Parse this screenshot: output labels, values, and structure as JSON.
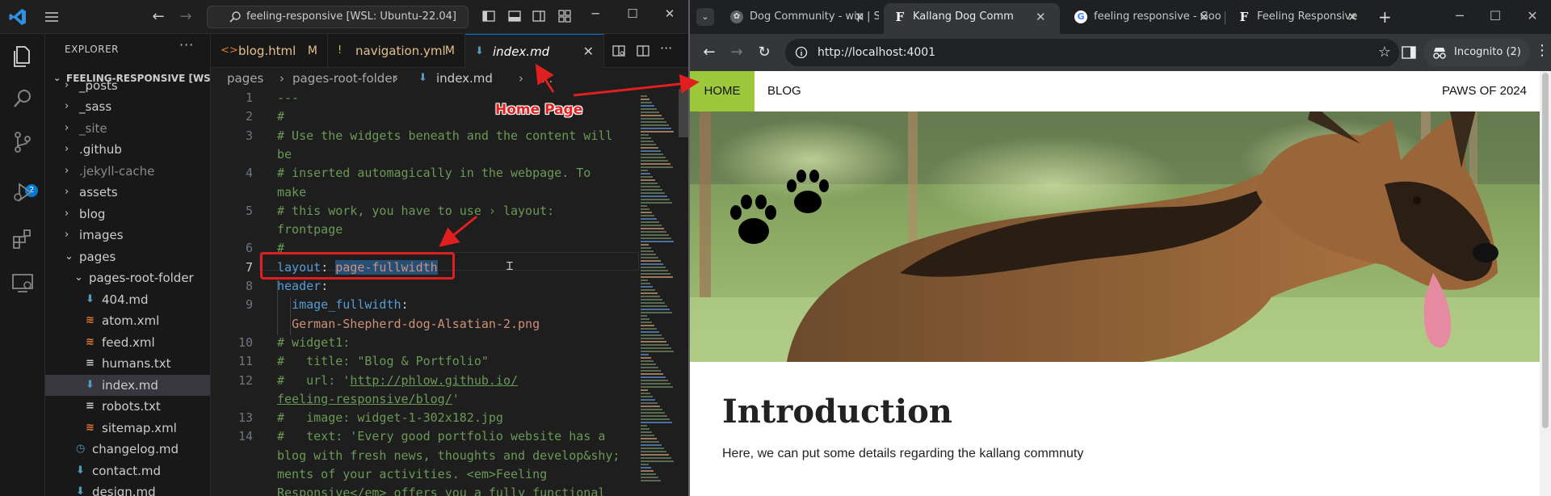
{
  "vscode": {
    "command_center": "feeling-responsive [WSL: Ubuntu-22.04]",
    "scm_badge": "2",
    "explorer_title": "EXPLORER",
    "workspace": "FEELING-RESPONSIVE [WSL: UBUNTU-22.04]",
    "tree": [
      {
        "label": "_posts",
        "type": "folder",
        "depth": 1,
        "dim": false
      },
      {
        "label": "_sass",
        "type": "folder",
        "depth": 1,
        "dim": false
      },
      {
        "label": "_site",
        "type": "folder",
        "depth": 1,
        "dim": true
      },
      {
        "label": ".github",
        "type": "folder",
        "depth": 1,
        "dim": false
      },
      {
        "label": ".jekyll-cache",
        "type": "folder",
        "depth": 1,
        "dim": true
      },
      {
        "label": "assets",
        "type": "folder",
        "depth": 1,
        "dim": false
      },
      {
        "label": "blog",
        "type": "folder",
        "depth": 1,
        "dim": false
      },
      {
        "label": "images",
        "type": "folder",
        "depth": 1,
        "dim": false
      },
      {
        "label": "pages",
        "type": "folder-open",
        "depth": 1,
        "dim": false
      },
      {
        "label": "pages-root-folder",
        "type": "folder-open",
        "depth": 2,
        "dim": false
      },
      {
        "label": "404.md",
        "type": "md",
        "depth": 3,
        "dim": false
      },
      {
        "label": "atom.xml",
        "type": "rss",
        "depth": 3,
        "dim": false
      },
      {
        "label": "feed.xml",
        "type": "rss",
        "depth": 3,
        "dim": false
      },
      {
        "label": "humans.txt",
        "type": "txt",
        "depth": 3,
        "dim": false
      },
      {
        "label": "index.md",
        "type": "md",
        "depth": 3,
        "dim": false,
        "selected": true
      },
      {
        "label": "robots.txt",
        "type": "txt",
        "depth": 3,
        "dim": false
      },
      {
        "label": "sitemap.xml",
        "type": "rss",
        "depth": 3,
        "dim": false
      },
      {
        "label": "changelog.md",
        "type": "clock",
        "depth": 2,
        "dim": false
      },
      {
        "label": "contact.md",
        "type": "md",
        "depth": 2,
        "dim": false
      },
      {
        "label": "design.md",
        "type": "md",
        "depth": 2,
        "dim": false
      }
    ],
    "tabs": [
      {
        "label": "blog.html",
        "icon": "<>",
        "icon_color": "#e37933",
        "mod": "M",
        "active": false
      },
      {
        "label": "navigation.yml",
        "icon": "!",
        "icon_color": "#cbcb41",
        "mod": "M",
        "active": false
      },
      {
        "label": "index.md",
        "icon": "md",
        "icon_color": "#519aba",
        "mod": "",
        "active": true
      }
    ],
    "breadcrumb": [
      "pages",
      ">",
      "pages-root-folder",
      ">",
      "index.md",
      ">",
      "..."
    ],
    "gutter": [
      "1",
      "2",
      "3",
      "",
      "4",
      "",
      "5",
      "",
      "6",
      "7",
      "8",
      "9",
      "",
      "10",
      "11",
      "12",
      "",
      "13",
      "14",
      "",
      "",
      "",
      ""
    ],
    "code": [
      "---",
      "#",
      "# Use the widgets beneath and the content will",
      "be",
      "# inserted automagically in the webpage. To",
      "make",
      "# this work, you have to use › layout:",
      "frontpage",
      "#",
      "layout: page-fullwidth",
      "header:",
      "  image_fullwidth:",
      "  German-Shepherd-dog-Alsatian-2.png",
      "# widget1:",
      "#   title: \"Blog & Portfolio\"",
      "#   url: 'http://phlow.github.io/",
      "feeling-responsive/blog/'",
      "#   image: widget-1-302x182.jpg",
      "#   text: 'Every good portfolio website has a",
      "blog with fresh news, thoughts and develop&shy;",
      "ments of your activities. <em>Feeling",
      "Responsive</em> offers you a fully functional"
    ]
  },
  "annotations": {
    "home_page_label": "Home Page",
    "color": "#e02020"
  },
  "chrome": {
    "tabs": [
      {
        "title": "Dog Community - wip | S",
        "active": false,
        "favicon": "paw"
      },
      {
        "title": "Kallang Dog Comm",
        "active": true,
        "favicon": "F"
      },
      {
        "title": "feeling responsive - Goo",
        "active": false,
        "favicon": "G"
      },
      {
        "title": "Feeling Responsive",
        "active": false,
        "favicon": "F"
      }
    ],
    "url": "http://localhost:4001",
    "incognito": "Incognito (2)"
  },
  "site": {
    "nav": {
      "home": "HOME",
      "blog": "BLOG",
      "brand": "PAWS OF 2024"
    },
    "accent": "#9dc83c",
    "heading": "Introduction",
    "paragraph": "Here, we can put some details regarding the kallang commnuty"
  }
}
